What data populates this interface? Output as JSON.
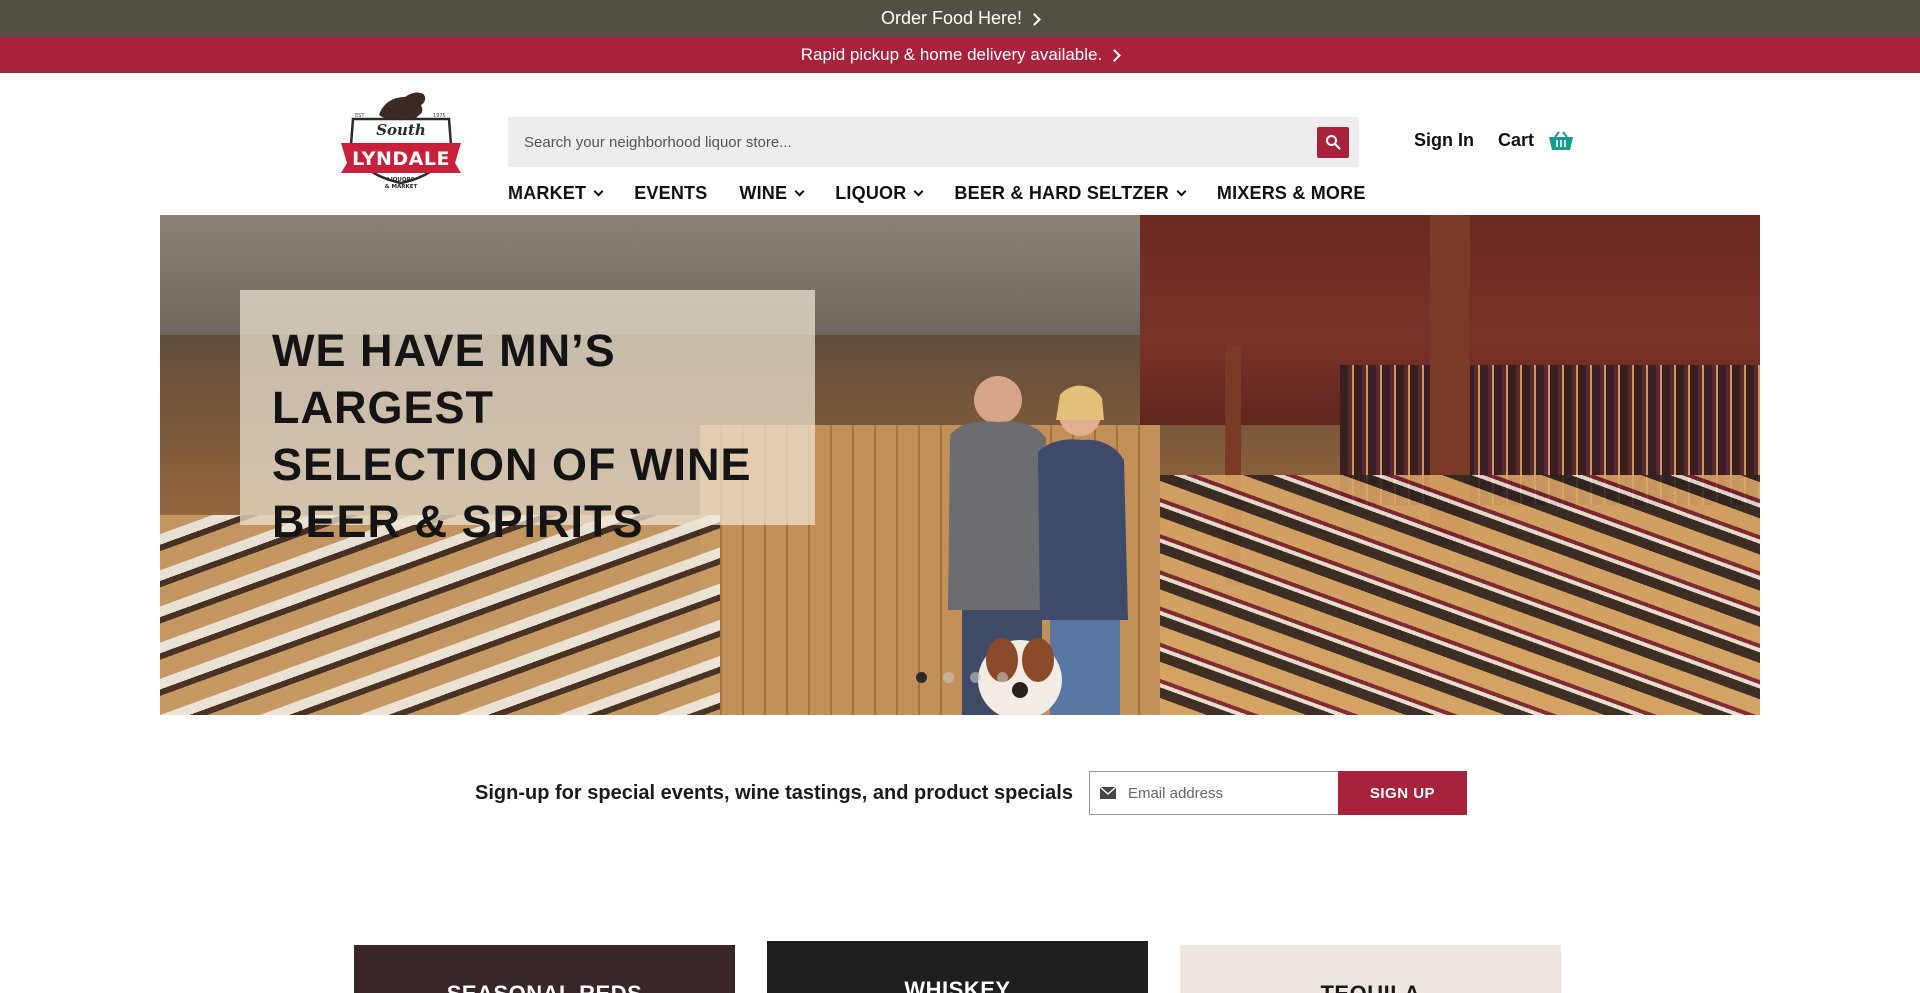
{
  "announcements": {
    "order_food": "Order Food Here!",
    "delivery": "Rapid pickup & home delivery available."
  },
  "header": {
    "logo_text": {
      "est": "EST",
      "year": "1975",
      "south": "South",
      "lyndale": "LYNDALE",
      "sub1": "LIQUORS",
      "sub2": "& MARKET"
    },
    "search_placeholder": "Search your neighborhood liquor store...",
    "sign_in": "Sign In",
    "cart": "Cart"
  },
  "nav": {
    "items": [
      {
        "label": "MARKET",
        "dropdown": true
      },
      {
        "label": "EVENTS",
        "dropdown": false
      },
      {
        "label": "WINE",
        "dropdown": true
      },
      {
        "label": "LIQUOR",
        "dropdown": true
      },
      {
        "label": "BEER & HARD SELTZER",
        "dropdown": true
      },
      {
        "label": "MIXERS & MORE",
        "dropdown": false
      }
    ]
  },
  "hero": {
    "headline": "WE HAVE MN’S LARGEST\nSELECTION OF WINE\nBEER & SPIRITS",
    "slide_count": 4,
    "active_slide": 1
  },
  "signup": {
    "text": "Sign-up for special events, wine tastings, and product specials",
    "email_placeholder": "Email address",
    "button": "SIGN UP"
  },
  "categories": [
    {
      "label": "SEASONAL REDS"
    },
    {
      "label": "WHISKEY"
    },
    {
      "label": "TEQUILA"
    }
  ],
  "colors": {
    "brand_red": "#a8223c",
    "top_bar": "#534f45"
  }
}
